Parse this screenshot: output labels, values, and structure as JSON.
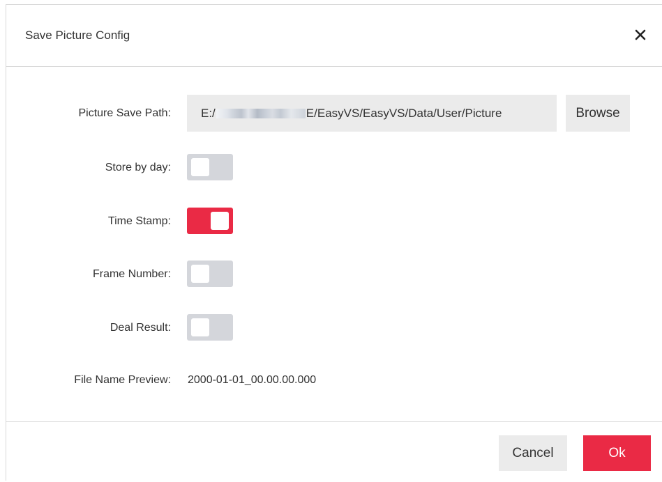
{
  "dialog": {
    "title": "Save Picture Config",
    "close_icon": "close-icon"
  },
  "form": {
    "picture_save_path": {
      "label": "Picture Save Path:",
      "value_prefix": "E:/",
      "value_suffix": "E/EasyVS/EasyVS/Data/User/Picture",
      "browse_label": "Browse"
    },
    "store_by_day": {
      "label": "Store by day:",
      "on": false
    },
    "time_stamp": {
      "label": "Time Stamp:",
      "on": true
    },
    "frame_number": {
      "label": "Frame Number:",
      "on": false
    },
    "deal_result": {
      "label": "Deal Result:",
      "on": false
    },
    "file_name_preview": {
      "label": "File Name Preview:",
      "value": "2000-01-01_00.00.00.000"
    }
  },
  "footer": {
    "cancel_label": "Cancel",
    "ok_label": "Ok"
  },
  "colors": {
    "accent": "#ea2a45",
    "toggle_off": "#d4d6db",
    "field_bg": "#ebebeb"
  }
}
